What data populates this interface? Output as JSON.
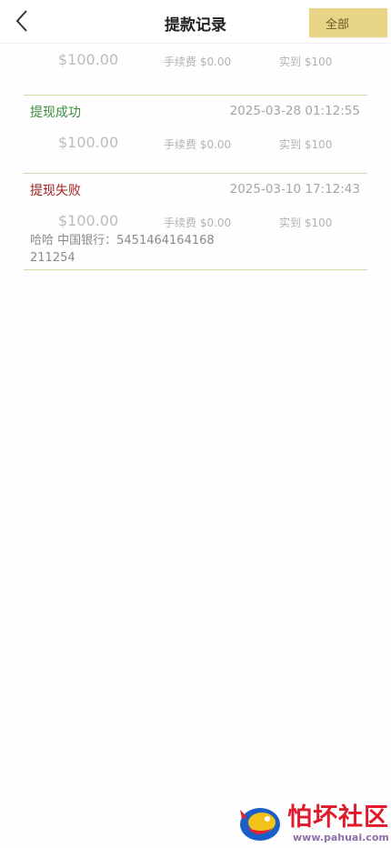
{
  "header": {
    "title": "提款记录",
    "filter_label": "全部"
  },
  "records": [
    {
      "status": "",
      "datetime": "",
      "amount": "$100.00",
      "fee": "手续费 $0.00",
      "received": "实到 $100"
    },
    {
      "status": "提现成功",
      "datetime": "2025-03-28 01:12:55",
      "amount": "$100.00",
      "fee": "手续费 $0.00",
      "received": "实到 $100"
    },
    {
      "status": "提现失败",
      "datetime": "2025-03-10 17:12:43",
      "amount": "$100.00",
      "fee": "手续费 $0.00",
      "received": "实到 $100",
      "bank_line1": "哈哈 中国银行：5451464164168",
      "bank_line2": "211254"
    }
  ],
  "watermark": {
    "name": "怕坏社区",
    "url": "www.pahuai.com"
  },
  "colors": {
    "filter_bg": "#e8d486",
    "success": "#3a8f3a",
    "fail": "#a32424",
    "divider": "#dcd6a8"
  },
  "icons": {
    "back": "chevron-left-icon",
    "logo": "pahuai-logo-icon"
  }
}
